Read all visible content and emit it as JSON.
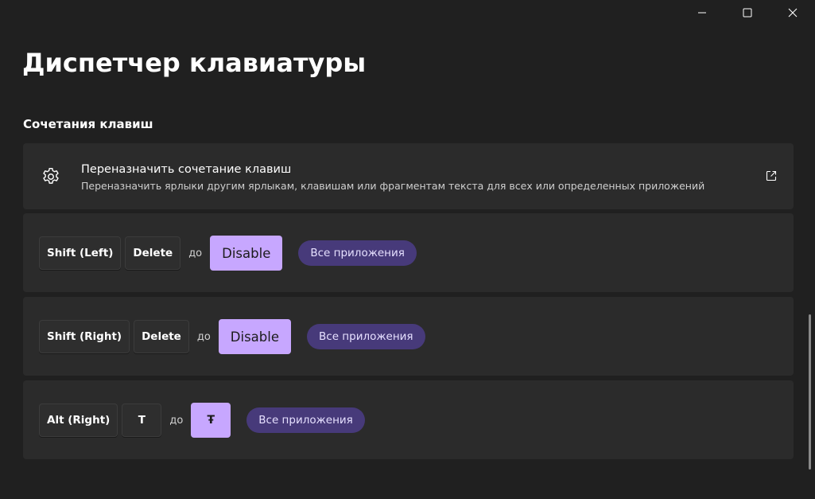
{
  "window": {
    "controls": {
      "minimize_icon": "minimize-icon",
      "maximize_icon": "maximize-icon",
      "close_icon": "close-icon"
    }
  },
  "page": {
    "title": "Диспетчер клавиатуры"
  },
  "section": {
    "title": "Сочетания клавиш"
  },
  "remap_card": {
    "icon": "gear-icon",
    "title": "Переназначить сочетание клавиш",
    "description": "Переназначить ярлыки другим ярлыкам, клавишам или фрагментам текста для всех или определенных приложений",
    "link_icon": "external-link-icon"
  },
  "shortcuts": [
    {
      "keys": [
        "Shift (Left)",
        "Delete"
      ],
      "to_label": "до",
      "target": "Disable",
      "scope": "Все приложения"
    },
    {
      "keys": [
        "Shift (Right)",
        "Delete"
      ],
      "to_label": "до",
      "target": "Disable",
      "scope": "Все приложения"
    },
    {
      "keys": [
        "Alt (Right)",
        "T"
      ],
      "to_label": "до",
      "target": "Ŧ",
      "scope": "Все приложения"
    }
  ],
  "colors": {
    "background": "#202020",
    "card": "#2b2b2b",
    "accent_target": "#c7a7ff",
    "scope_pill": "#473a7a"
  }
}
